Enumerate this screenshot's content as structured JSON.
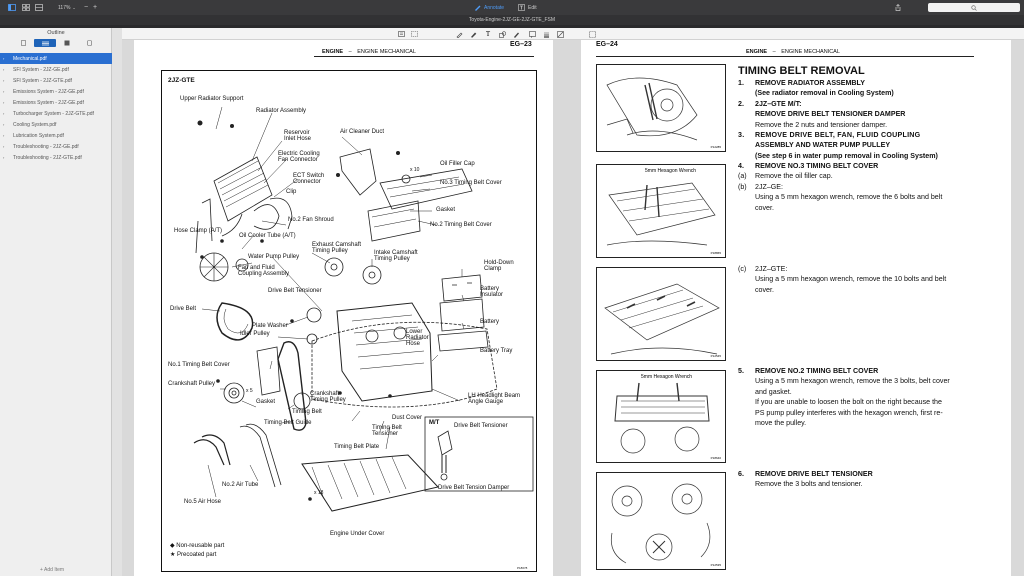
{
  "toolbar": {
    "zoom": "117%",
    "annotate_label": "Annotate",
    "edit_label": "Edit"
  },
  "window": {
    "title": "Toyota-Engine-2JZ-GE-2JZ-GTE_FSM"
  },
  "sidebar": {
    "title": "Outline",
    "items": [
      {
        "label": "Mechanical.pdf"
      },
      {
        "label": "SFI System - 2JZ-GE.pdf"
      },
      {
        "label": "SFI System - 2JZ-GTE.pdf"
      },
      {
        "label": "Emissions System - 2JZ-GE.pdf"
      },
      {
        "label": "Emissions System - 2JZ-GE.pdf"
      },
      {
        "label": "Turbocharger System - 2JZ-GTE.pdf"
      },
      {
        "label": "Cooling System.pdf"
      },
      {
        "label": "Lubrication System.pdf"
      },
      {
        "label": "Troubleshooting - 2JZ-GE.pdf"
      },
      {
        "label": "Troubleshooting - 2JZ-GTE.pdf"
      }
    ],
    "add_item": "+ Add Item"
  },
  "left_page": {
    "header_section": "ENGINE",
    "header_sep": "–",
    "header_sub": "ENGINE MECHANICAL",
    "page_no": "EG–23",
    "diagram": {
      "title": "2JZ-GTE",
      "labels": {
        "upper_radiator_support": "Upper Radiator Support",
        "radiator_assembly": "Radiator Assembly",
        "reservoir_inlet_hose": "Reservoir\nInlet Hose",
        "air_cleaner_duct": "Air Cleaner Duct",
        "electric_cooling": "Electric Cooling\nFan Connector",
        "ect_switch": "ECT Switch\nConnector",
        "clip": "Clip",
        "oil_filler_cap": "Oil Filler Cap",
        "x10": "x 10",
        "no3_cover": "No.3 Timing Belt Cover",
        "no2_fan_shroud": "No.2 Fan Shroud",
        "gasket_top": "Gasket",
        "no2_cover": "No.2 Timing Belt Cover",
        "hose_clamp": "Hose Clamp (A/T)",
        "oil_cooler_tube": "Oil Cooler Tube (A/T)",
        "exhaust_cam": "Exhaust Camshaft\nTiming Pulley",
        "intake_cam": "Intake Camshaft\nTiming Pulley",
        "water_pump": "Water Pump Pulley",
        "hold_down": "Hold-Down\nClamp",
        "fan_fluid": "Fan and Fluid\nCoupling Assembly",
        "drive_belt_tensioner": "Drive Belt Tensioner",
        "battery_insulator": "Battery\nInsulator",
        "drive_belt": "Drive Belt",
        "plate_washer": "Plate Washer",
        "idler_pulley": "Idler Pulley",
        "battery": "Battery",
        "lower_radiator_hose": "Lower\nRadiator\nHose",
        "battery_tray": "Battery Tray",
        "no1_cover": "No.1 Timing Belt Cover",
        "crankshaft_pulley": "Crankshaft Pulley",
        "x5": "x 5",
        "crankshaft_timing": "Crankshaft\nTiming Pulley",
        "gasket_low": "Gasket",
        "lh_headlight": "LH Headlight Beam\nAngle Gauge",
        "timing_belt": "Timing Belt",
        "timing_belt_guide": "Timing Belt Guide",
        "dust_cover": "Dust Cover",
        "timing_belt_tensioner": "Timing Belt\nTensioner",
        "mt": "M/T",
        "mt_drive_belt_tensioner": "Drive Belt Tensioner",
        "timing_belt_plate": "Timing Belt Plate",
        "no2_air_tube": "No.2 Air Tube",
        "x18": "x 18",
        "drive_belt_damper": "Drive Belt Tension Damper",
        "no5_air_hose": "No.5 Air Hose",
        "engine_under_cover": "Engine Under Cover",
        "legend_nonreusable": "◆  Non-reusable part",
        "legend_precoated": "★  Precoated part",
        "fig_code": "P18678"
      }
    }
  },
  "right_page": {
    "page_no": "EG–24",
    "header_section": "ENGINE",
    "header_sep": "–",
    "header_sub": "ENGINE MECHANICAL",
    "title": "TIMING BELT REMOVAL",
    "figures": [
      {
        "caption": "",
        "code": "P12285"
      },
      {
        "caption": "5mm Hexagon Wrench",
        "code": "P18865"
      },
      {
        "caption": "",
        "code": "P12545"
      },
      {
        "caption": "5mm Hexagon Wrench",
        "code": "P18640"
      },
      {
        "caption": "",
        "code": "P12535"
      }
    ],
    "steps": {
      "s1_n": "1.",
      "s1_t": "REMOVE RADIATOR ASSEMBLY",
      "s1_sub": "(See radiator removal in Cooling System)",
      "s2_n": "2.",
      "s2_t": "2JZ–GTE M/T:",
      "s2_t2": "REMOVE DRIVE BELT TENSIONER DAMPER",
      "s2_sub": "Remove the 2 nuts and tensioner damper.",
      "s3_n": "3.",
      "s3_t": "REMOVE DRIVE BELT, FAN, FLUID COUPLING",
      "s3_t2": "ASSEMBLY AND WATER PUMP PULLEY",
      "s3_sub": "(See step 6 in water pump removal in Cooling System)",
      "s4_n": "4.",
      "s4_t": "REMOVE NO.3 TIMING BELT COVER",
      "s4a_n": "(a)",
      "s4a_t": "Remove the oil filler cap.",
      "s4b_n": "(b)",
      "s4b_t": "2JZ–GE:",
      "s4b_t2": "Using a 5 mm hexagon wrench, remove the 6 bolts and belt",
      "s4b_t3": "cover.",
      "s4c_n": "(c)",
      "s4c_t": "2JZ–GTE:",
      "s4c_t2": "Using a 5 mm hexagon wrench, remove the 10 bolts and belt",
      "s4c_t3": "cover.",
      "s5_n": "5.",
      "s5_t": "REMOVE NO.2 TIMING BELT COVER",
      "s5_l1": "Using a 5 mm hexagon wrench, remove the 3 bolts, belt cover",
      "s5_l2": "and gasket.",
      "s5_l3": "If you are unable to loosen the bolt on the right because the",
      "s5_l4": "PS pump pulley interferes with the hexagon wrench, first re-",
      "s5_l5": "move the pulley.",
      "s6_n": "6.",
      "s6_t": "REMOVE DRIVE BELT TENSIONER",
      "s6_sub": "Remove the 3 bolts and tensioner."
    }
  }
}
